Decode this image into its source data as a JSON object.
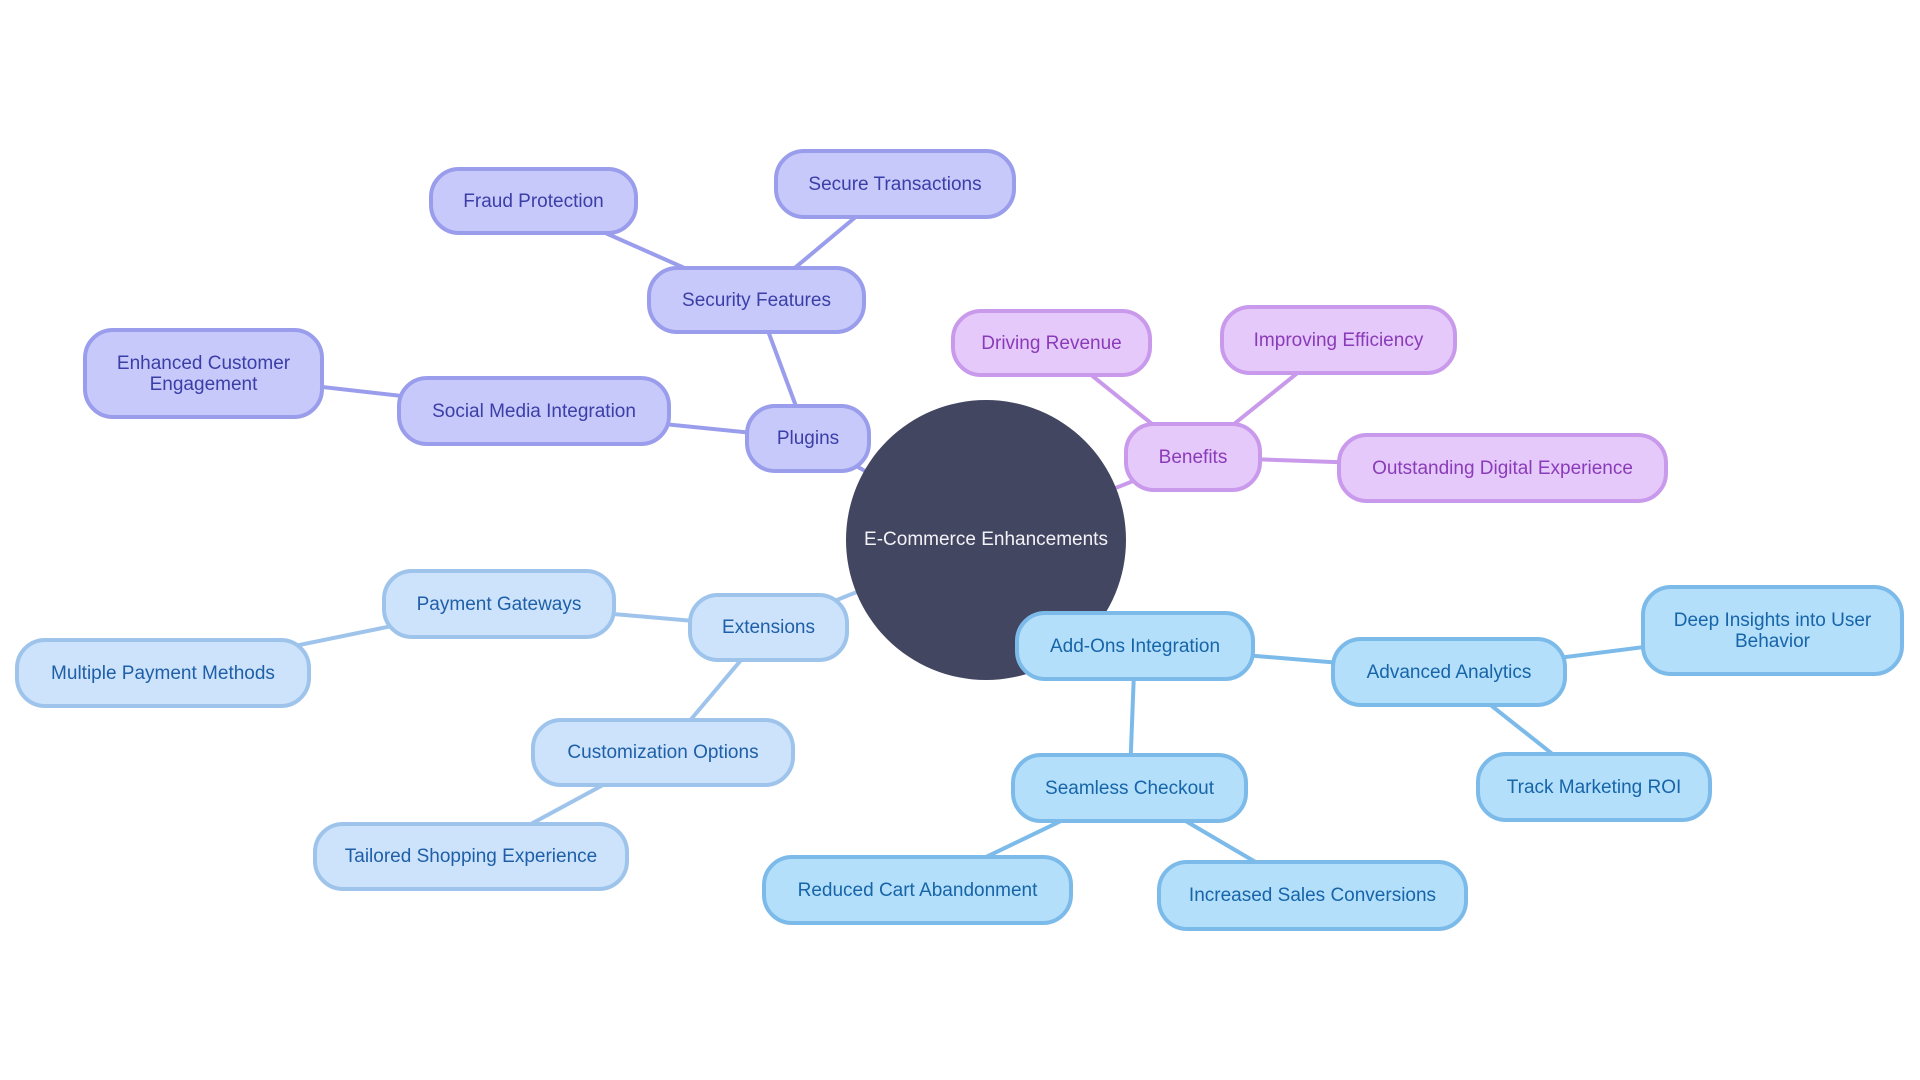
{
  "diagram": {
    "type": "mindmap",
    "root": {
      "id": "root",
      "label": "E-Commerce Enhancements",
      "color": "#424660"
    },
    "branches": [
      {
        "id": "plugins",
        "label": "Plugins",
        "theme": "c-plugins",
        "colors": {
          "fill": "#c7c9fb",
          "stroke": "#9a9deb",
          "text": "#3b3ea6"
        },
        "children": [
          {
            "id": "security",
            "label": "Security Features",
            "children": [
              {
                "id": "fraud",
                "label": "Fraud Protection"
              },
              {
                "id": "securetx",
                "label": "Secure Transactions"
              }
            ]
          },
          {
            "id": "social",
            "label": "Social Media Integration",
            "children": [
              {
                "id": "engagement",
                "label": "Enhanced Customer Engagement"
              }
            ]
          }
        ]
      },
      {
        "id": "benefits",
        "label": "Benefits",
        "theme": "c-benefits",
        "colors": {
          "fill": "#e6c9fb",
          "stroke": "#c99aeb",
          "text": "#8a3bb8"
        },
        "children": [
          {
            "id": "revenue",
            "label": "Driving Revenue"
          },
          {
            "id": "efficiency",
            "label": "Improving Efficiency"
          },
          {
            "id": "digital",
            "label": "Outstanding Digital Experience"
          }
        ]
      },
      {
        "id": "extensions",
        "label": "Extensions",
        "theme": "c-ext",
        "colors": {
          "fill": "#cde3fb",
          "stroke": "#9ec4ec",
          "text": "#1e5fa8"
        },
        "children": [
          {
            "id": "payment",
            "label": "Payment Gateways",
            "children": [
              {
                "id": "multipay",
                "label": "Multiple Payment Methods"
              }
            ]
          },
          {
            "id": "custom",
            "label": "Customization Options",
            "children": [
              {
                "id": "tailored",
                "label": "Tailored Shopping Experience"
              }
            ]
          }
        ]
      },
      {
        "id": "addons",
        "label": "Add-Ons Integration",
        "theme": "c-addons",
        "colors": {
          "fill": "#b3dffb",
          "stroke": "#7cbbe9",
          "text": "#1765a8"
        },
        "children": [
          {
            "id": "analytics",
            "label": "Advanced Analytics",
            "children": [
              {
                "id": "insights",
                "label": "Deep Insights into User Behavior"
              },
              {
                "id": "roi",
                "label": "Track Marketing ROI"
              }
            ]
          },
          {
            "id": "checkout",
            "label": "Seamless Checkout",
            "children": [
              {
                "id": "cart",
                "label": "Reduced Cart Abandonment"
              },
              {
                "id": "conversions",
                "label": "Increased Sales Conversions"
              }
            ]
          }
        ]
      }
    ]
  }
}
